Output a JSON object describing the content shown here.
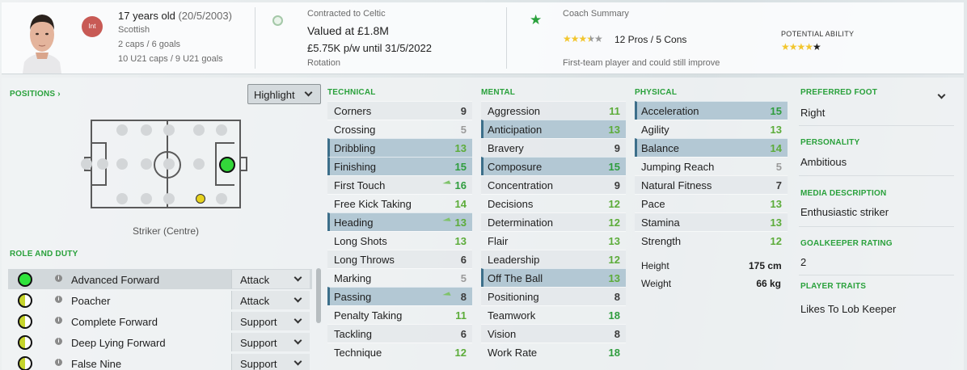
{
  "header": {
    "age": "17 years old",
    "dob": "(20/5/2003)",
    "nationality": "Scottish",
    "caps": "2 caps / 6 goals",
    "u21": "10 U21 caps / 9 U21 goals",
    "int_badge": "Int",
    "contract_title": "Contracted to Celtic",
    "value": "Valued at £1.8M",
    "wage": "£5.75K p/w until 31/5/2022",
    "squad_status": "Rotation",
    "coach_title": "Coach Summary",
    "coach_stars": 3.5,
    "pros_cons": "12 Pros / 5 Cons",
    "coach_note": "First-team player and could still improve",
    "potential_label": "POTENTIAL ABILITY",
    "potential_stars": 4
  },
  "positions": {
    "title": "POSITIONS",
    "highlight_label": "Highlight",
    "position_name": "Striker (Centre)"
  },
  "roles": {
    "title": "ROLE AND DUTY",
    "items": [
      {
        "name": "Advanced Forward",
        "duty": "Attack",
        "rating": "full"
      },
      {
        "name": "Poacher",
        "duty": "Attack",
        "rating": "half"
      },
      {
        "name": "Complete Forward",
        "duty": "Support",
        "rating": "half"
      },
      {
        "name": "Deep Lying Forward",
        "duty": "Support",
        "rating": "half"
      },
      {
        "name": "False Nine",
        "duty": "Support",
        "rating": "half"
      }
    ]
  },
  "technical": {
    "title": "TECHNICAL",
    "items": [
      {
        "name": "Corners",
        "value": "9"
      },
      {
        "name": "Crossing",
        "value": "5"
      },
      {
        "name": "Dribbling",
        "value": "13"
      },
      {
        "name": "Finishing",
        "value": "15"
      },
      {
        "name": "First Touch",
        "value": "16"
      },
      {
        "name": "Free Kick Taking",
        "value": "14"
      },
      {
        "name": "Heading",
        "value": "13"
      },
      {
        "name": "Long Shots",
        "value": "13"
      },
      {
        "name": "Long Throws",
        "value": "6"
      },
      {
        "name": "Marking",
        "value": "5"
      },
      {
        "name": "Passing",
        "value": "8"
      },
      {
        "name": "Penalty Taking",
        "value": "11"
      },
      {
        "name": "Tackling",
        "value": "6"
      },
      {
        "name": "Technique",
        "value": "12"
      }
    ]
  },
  "mental": {
    "title": "MENTAL",
    "items": [
      {
        "name": "Aggression",
        "value": "11"
      },
      {
        "name": "Anticipation",
        "value": "13"
      },
      {
        "name": "Bravery",
        "value": "9"
      },
      {
        "name": "Composure",
        "value": "15"
      },
      {
        "name": "Concentration",
        "value": "9"
      },
      {
        "name": "Decisions",
        "value": "12"
      },
      {
        "name": "Determination",
        "value": "12"
      },
      {
        "name": "Flair",
        "value": "13"
      },
      {
        "name": "Leadership",
        "value": "12"
      },
      {
        "name": "Off The Ball",
        "value": "13"
      },
      {
        "name": "Positioning",
        "value": "8"
      },
      {
        "name": "Teamwork",
        "value": "18"
      },
      {
        "name": "Vision",
        "value": "8"
      },
      {
        "name": "Work Rate",
        "value": "18"
      }
    ]
  },
  "physical": {
    "title": "PHYSICAL",
    "items": [
      {
        "name": "Acceleration",
        "value": "15"
      },
      {
        "name": "Agility",
        "value": "13"
      },
      {
        "name": "Balance",
        "value": "14"
      },
      {
        "name": "Jumping Reach",
        "value": "5"
      },
      {
        "name": "Natural Fitness",
        "value": "7"
      },
      {
        "name": "Pace",
        "value": "13"
      },
      {
        "name": "Stamina",
        "value": "13"
      },
      {
        "name": "Strength",
        "value": "12"
      }
    ],
    "height_label": "Height",
    "height": "175 cm",
    "weight_label": "Weight",
    "weight": "66 kg"
  },
  "side": {
    "foot_label": "PREFERRED FOOT",
    "foot": "Right",
    "personality_label": "PERSONALITY",
    "personality": "Ambitious",
    "media_label": "MEDIA DESCRIPTION",
    "media": "Enthusiastic striker",
    "gk_label": "GOALKEEPER RATING",
    "gk": "2",
    "traits_label": "PLAYER TRAITS",
    "trait": "Likes To Lob Keeper"
  },
  "colors": {
    "accent": "#2aa13c",
    "highlight_row": "#b3c8d4",
    "highlight_border": "#3d6f8a",
    "badge": "#c85a55",
    "star": "#f2c62f",
    "role_full": "#2fe33b",
    "role_half": "#c6d52c"
  }
}
